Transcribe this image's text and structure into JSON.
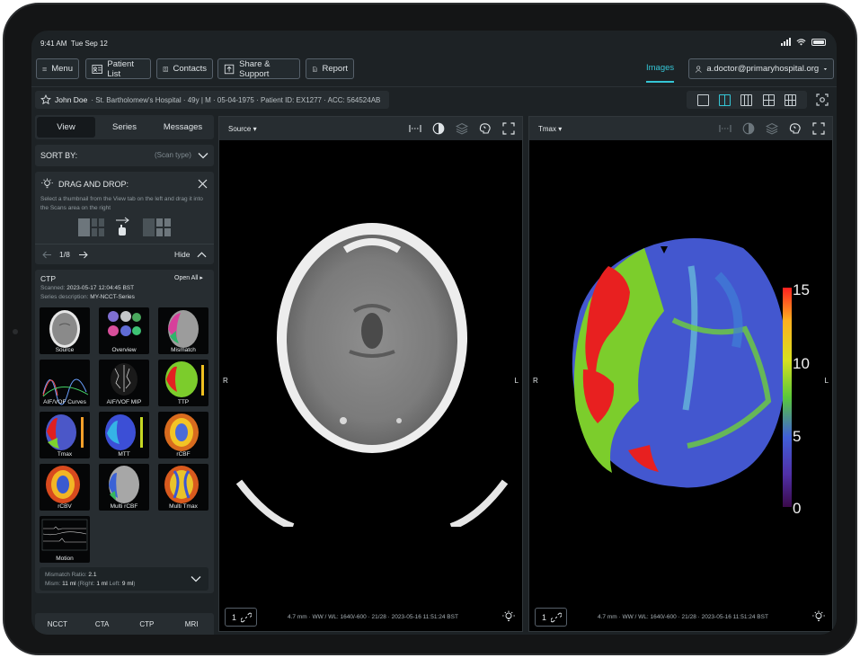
{
  "status": {
    "time": "9:41 AM",
    "date": "Tue Sep 12"
  },
  "toolbar": {
    "menu": "Menu",
    "patient_list": "Patient List",
    "contacts": "Contacts",
    "share": "Share & Support",
    "report": "Report",
    "images_tab": "Images",
    "user": "a.doctor@primaryhospital.org"
  },
  "patient": {
    "name": "John Doe",
    "details": "· St. Bartholomew's Hospital · 49y | M · 05-04-1975 · Patient ID: EX1277 · ACC: 564524AB"
  },
  "left": {
    "tabs": [
      "View",
      "Series",
      "Messages"
    ],
    "sort_label": "SORT BY:",
    "sort_value": "(Scan type)",
    "dnd_title": "DRAG AND DROP:",
    "dnd_desc": "Select a thumbnail from the View tab on the left and drag it into the Scans area on the right",
    "page": "1/8",
    "hide": "Hide",
    "ctp": {
      "title": "CTP",
      "open_all": "Open All",
      "scanned_label": "Scanned:",
      "scanned_value": "2023-05-17 12:04:45 BST",
      "series_label": "Series description:",
      "series_value": "MY-NCCT-Series",
      "thumbs": [
        "Source",
        "Overview",
        "Mismatch",
        "AIF/VOF Curves",
        "AIF/VOF MIP",
        "TTP",
        "Tmax",
        "MTT",
        "rCBF",
        "rCBV",
        "Multi rCBF",
        "Multi Tmax",
        "Motion"
      ],
      "ratio_label": "Mismatch Ratio:",
      "ratio_value": "2.1",
      "mism_label": "Mism:",
      "mism_value": "11 ml",
      "right_label": "Right:",
      "right_value": "1 ml",
      "left_label": "Left:",
      "left_value": "9 ml"
    },
    "modalities": [
      "NCCT",
      "CTA",
      "CTP",
      "MRI"
    ]
  },
  "viewports": [
    {
      "title": "Source",
      "left": "R",
      "right": "L",
      "slice": "1",
      "info": "4.7 mm · WW / WL: 1640/-600 · 21/28 · 2023-05-16 11:51:24 BST"
    },
    {
      "title": "Tmax",
      "left": "R",
      "right": "L",
      "slice": "1",
      "info": "4.7 mm · WW / WL: 1640/-600 · 21/28 · 2023-05-16 11:51:24 BST"
    }
  ],
  "colorbar": {
    "ticks": [
      "15",
      "10",
      "5",
      "0"
    ],
    "max": 15,
    "min": 0
  },
  "colors": {
    "accent": "#35c6d6",
    "panel": "#272d31",
    "background": "#1d2225"
  }
}
